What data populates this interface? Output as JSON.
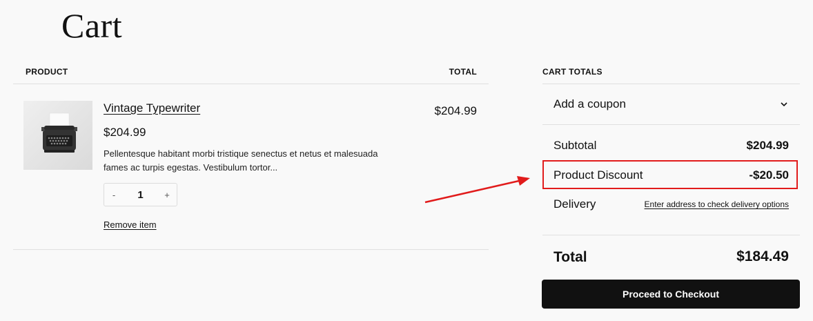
{
  "page": {
    "title": "Cart"
  },
  "table": {
    "col_product": "PRODUCT",
    "col_total": "TOTAL"
  },
  "item": {
    "name": "Vintage Typewriter",
    "price": "$204.99",
    "description": "Pellentesque habitant morbi tristique senectus et netus et malesuada fames ac turpis egestas. Vestibulum tortor...",
    "qty_minus": "-",
    "quantity": "1",
    "qty_plus": "+",
    "remove_label": "Remove item",
    "line_total": "$204.99"
  },
  "totals": {
    "heading": "CART TOTALS",
    "coupon_label": "Add a coupon",
    "subtotal_label": "Subtotal",
    "subtotal_value": "$204.99",
    "discount_label": "Product Discount",
    "discount_value": "-$20.50",
    "delivery_label": "Delivery",
    "delivery_link": "Enter address to check delivery options",
    "total_label": "Total",
    "total_value": "$184.49",
    "checkout_label": "Proceed to Checkout"
  },
  "annotation": {
    "highlight_color": "#e11b1b"
  }
}
